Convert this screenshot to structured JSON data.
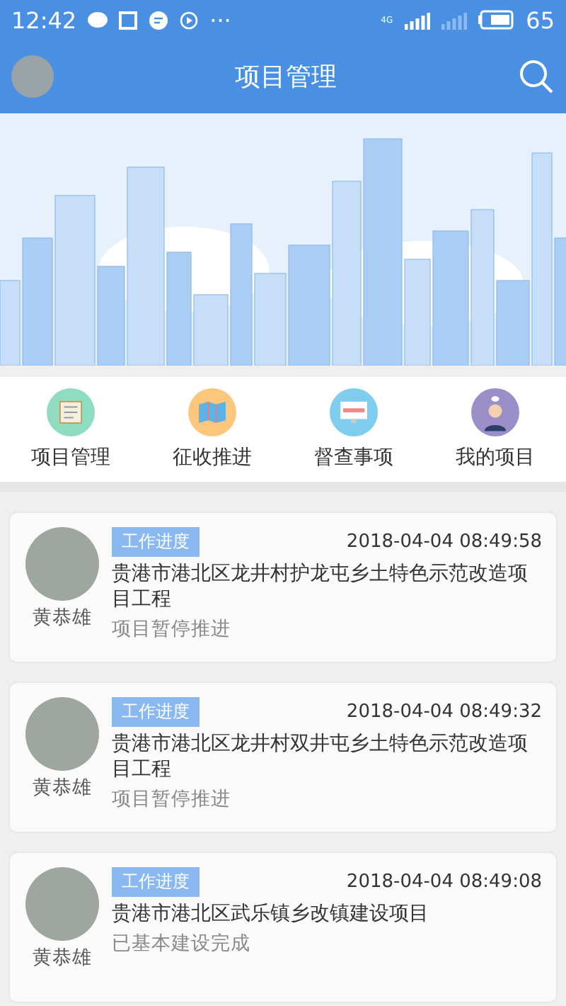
{
  "status_bar": {
    "time": "12:42",
    "dots": "···",
    "network": "4G",
    "battery": "65"
  },
  "header": {
    "title": "项目管理"
  },
  "menu": [
    {
      "label": "项目管理",
      "kind": "book",
      "color": "#8fdcc0"
    },
    {
      "label": "征收推进",
      "kind": "map",
      "color": "#fcc77c"
    },
    {
      "label": "督查事项",
      "kind": "monitor",
      "color": "#7fcdee"
    },
    {
      "label": "我的项目",
      "kind": "person",
      "color": "#9a8fc9"
    }
  ],
  "feed": [
    {
      "author": "黄恭雄",
      "tag": "工作进度",
      "time": "2018-04-04 08:49:58",
      "title": "贵港市港北区龙井村护龙屯乡土特色示范改造项目工程",
      "status": "项目暂停推进"
    },
    {
      "author": "黄恭雄",
      "tag": "工作进度",
      "time": "2018-04-04 08:49:32",
      "title": "贵港市港北区龙井村双井屯乡土特色示范改造项目工程",
      "status": "项目暂停推进"
    },
    {
      "author": "黄恭雄",
      "tag": "工作进度",
      "time": "2018-04-04 08:49:08",
      "title": "贵港市港北区武乐镇乡改镇建设项目",
      "status": "已基本建设完成"
    }
  ]
}
